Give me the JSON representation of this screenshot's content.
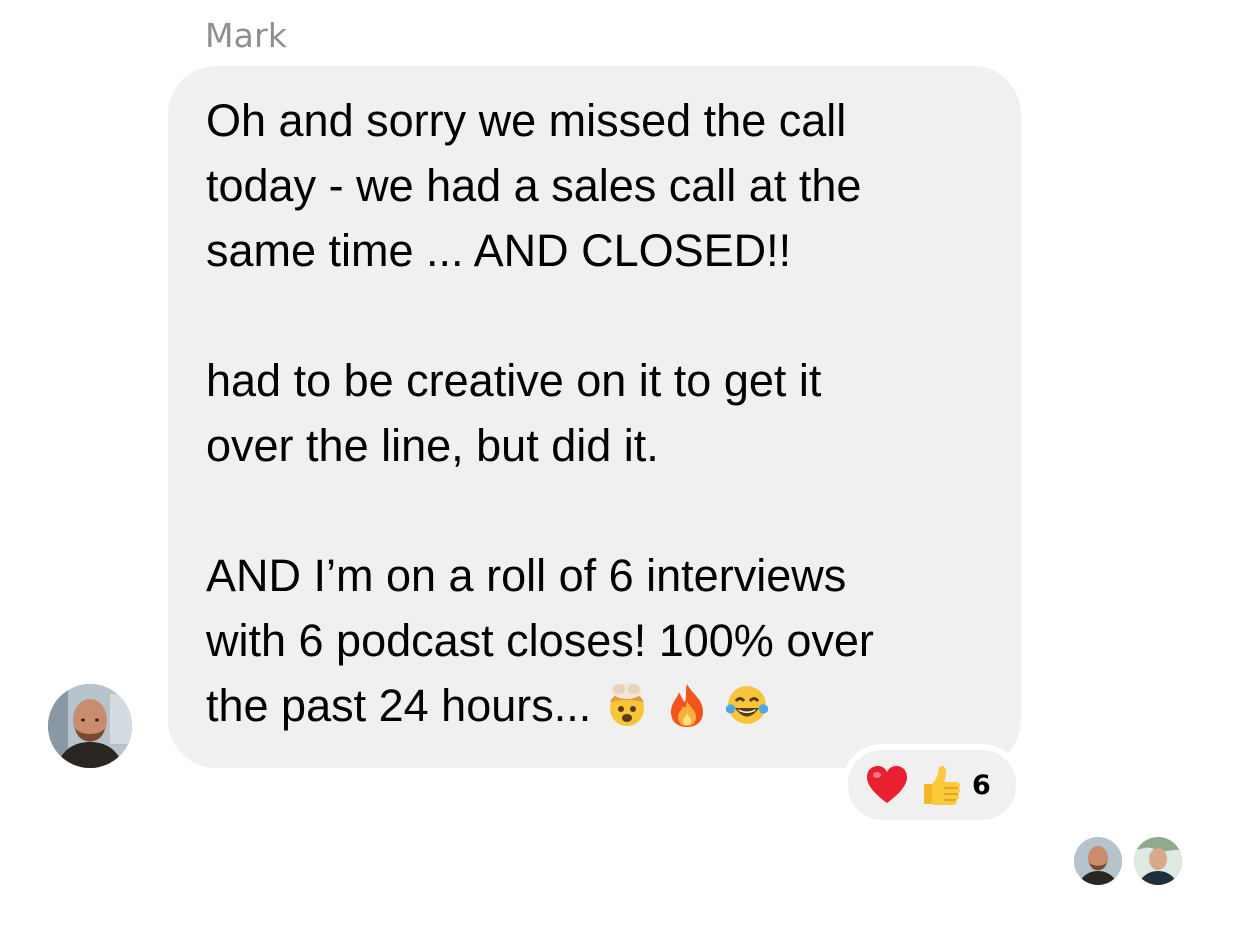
{
  "message": {
    "sender_name": "Mark",
    "paragraphs": [
      "Oh and sorry we missed the call\ntoday - we had a sales call at the\nsame time ... AND CLOSED!!",
      "had to be creative on it to get it\nover the line, but did it.",
      "AND I’m on a roll of 6 interviews\nwith 6 podcast closes! 100% over\nthe past 24 hours..."
    ],
    "trailing_emojis": [
      "exploding-head-emoji",
      "fire-emoji",
      "tears-of-joy-emoji"
    ]
  },
  "reactions": {
    "icons": [
      "red-heart-emoji",
      "thumbs-up-emoji"
    ],
    "count": "6"
  },
  "read_receipts": [
    "avatar-mark",
    "avatar-viewer"
  ],
  "colors": {
    "bubble": "#f0f0f0",
    "sender_name": "#8e8e93",
    "background": "#ffffff"
  }
}
